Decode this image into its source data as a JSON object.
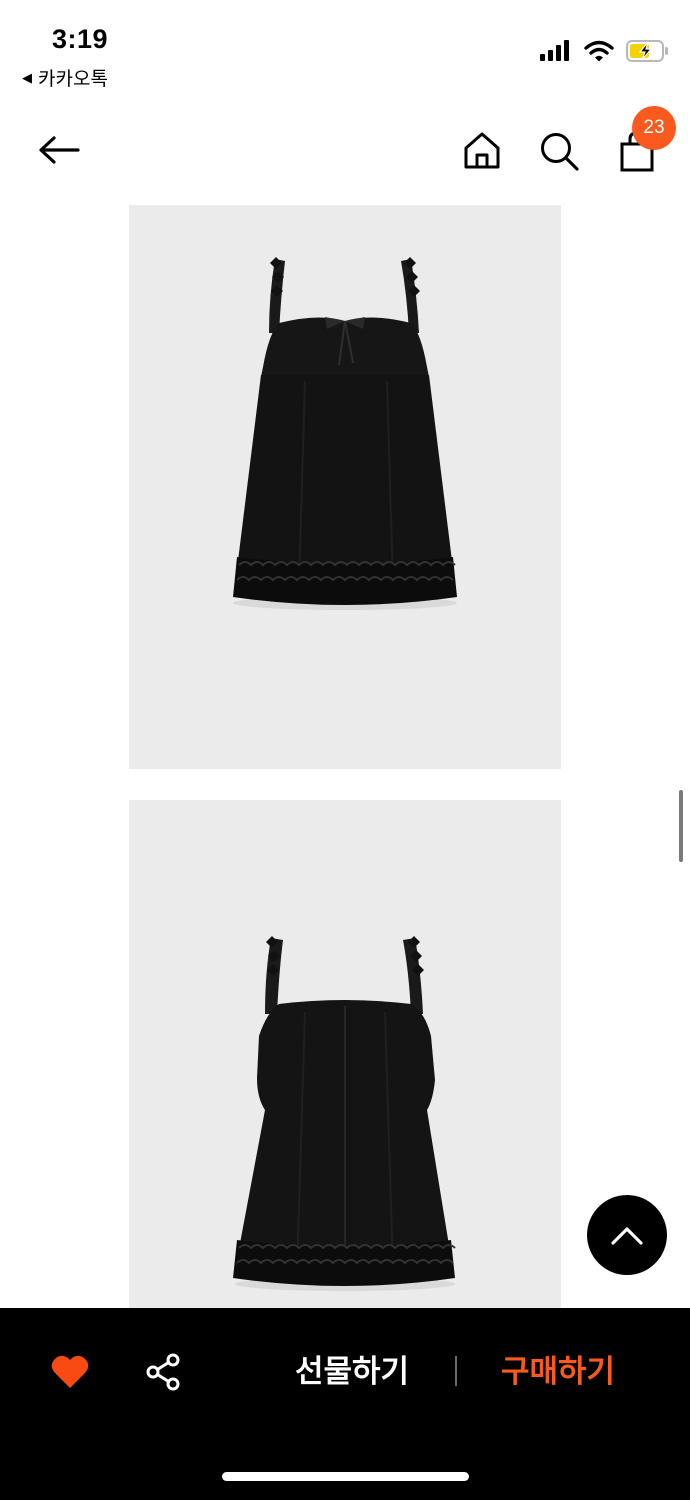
{
  "status_bar": {
    "time": "3:19",
    "back_app_label": "카카오톡",
    "icons": [
      "cellular-signal-icon",
      "wifi-icon",
      "battery-charging-icon"
    ]
  },
  "header": {
    "icons": [
      "back-arrow-icon",
      "home-icon",
      "search-icon",
      "shopping-bag-icon"
    ],
    "cart_count": "23"
  },
  "product_images": [
    {
      "view": "front",
      "subject": "black sleeveless ruffle-hem mini dress"
    },
    {
      "view": "back",
      "subject": "black sleeveless ruffle-hem mini dress"
    }
  ],
  "floating": {
    "scroll_top_icon": "chevron-up-icon"
  },
  "bottom_bar": {
    "like_icon": "heart-icon",
    "share_icon": "share-icon",
    "gift_label": "선물하기",
    "buy_label": "구매하기"
  },
  "colors": {
    "accent": "#fa5a1e",
    "photo_background": "#ebebeb",
    "bottom_bar": "#000000"
  }
}
